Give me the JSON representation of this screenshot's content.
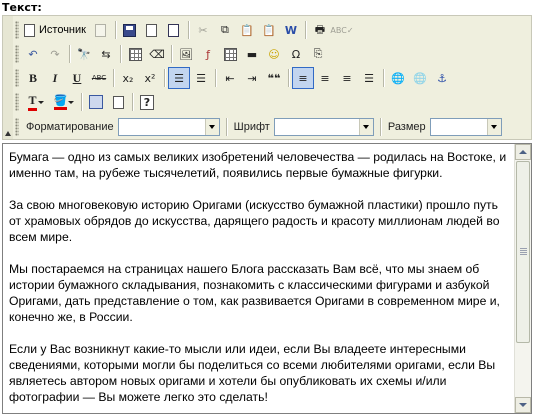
{
  "field": {
    "label": "Текст:"
  },
  "toolbar": {
    "source_label": "Источник",
    "format_label": "Форматирование",
    "font_label": "Шрифт",
    "size_label": "Размер",
    "format_value": "",
    "font_value": "",
    "size_value": "",
    "bold_label": "B",
    "italic_label": "I",
    "underline_label": "U",
    "strike_label": "ABC",
    "subscript_label": "x₂",
    "superscript_label": "x²",
    "quote_label": "❝❝",
    "text_color_label": "T",
    "help_label": "?",
    "active_buttons": [
      "numbered-list",
      "align-left"
    ]
  },
  "colors": {
    "toolbar_bg": "#efefde",
    "active_bg": "#c2d5ef",
    "active_border": "#316ac5",
    "scrollbar_arrow": "#4d6185"
  },
  "editor": {
    "paragraphs": [
      "Бумага — одно из самых великих изобретений человечества — родилась на Востоке, и именно там, на рубеже тысячелетий, появились первые бумажные фигурки.",
      "За свою многовековую историю Оригами (искусство бумажной пластики) прошло путь от храмовых обрядов до искусства, дарящего радость и красоту миллионам людей во всем мире.",
      "Мы постараемся на страницах нашего Блога рассказать Вам всё, что мы знаем об истории бумажного складывания, познакомить с классическими фигурами и азбукой Оригами, дать представление о том, как развивается Оригами в современном мире и, конечно же, в России.",
      "Если у Вас возникнут какие-то мысли или идеи, если Вы владеете интересными сведениями, которыми могли бы поделиться со всеми любителями оригами, если Вы являетесь автором новых оригами и хотели бы опубликовать их схемы и/или фотографии — Вы можете легко это сделать!"
    ]
  }
}
